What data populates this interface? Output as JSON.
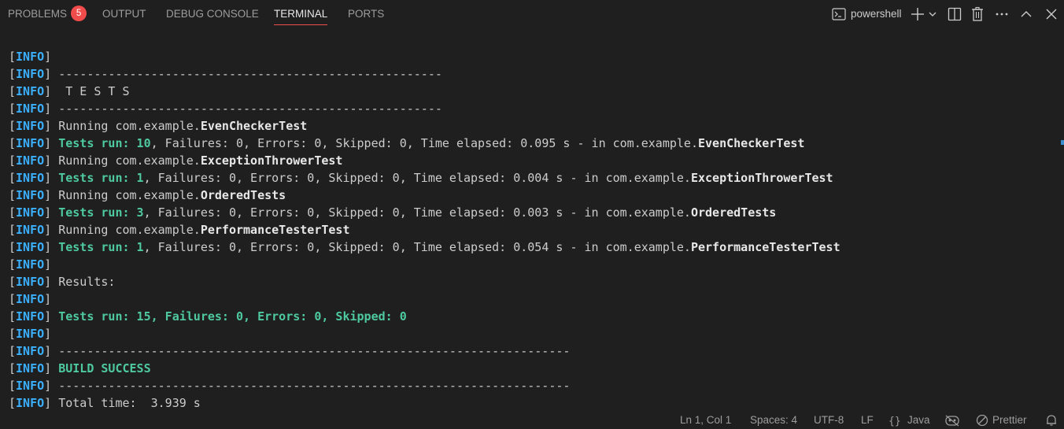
{
  "tabs": {
    "problems": "PROBLEMS",
    "problems_count": "5",
    "output": "OUTPUT",
    "debug_console": "DEBUG CONSOLE",
    "terminal": "TERMINAL",
    "ports": "PORTS"
  },
  "toolbar": {
    "shell": "powershell"
  },
  "terminal": {
    "lines": [
      [
        [
          "INFO"
        ]
      ],
      [
        [
          "INFO"
        ],
        [
          " ------------------------------------------------------",
          ""
        ]
      ],
      [
        [
          "INFO"
        ],
        [
          "  T E S T S",
          ""
        ]
      ],
      [
        [
          "INFO"
        ],
        [
          " ------------------------------------------------------",
          ""
        ]
      ],
      [
        [
          "INFO"
        ],
        [
          " Running com.example.",
          ""
        ],
        [
          "EvenCheckerTest",
          "b"
        ]
      ],
      [
        [
          "INFO"
        ],
        [
          " ",
          ""
        ],
        [
          "Tests run: 10",
          "g"
        ],
        [
          ", Failures: 0, Errors: 0, Skipped: 0, Time elapsed: 0.095 s - in com.example.",
          ""
        ],
        [
          "EvenCheckerTest",
          "b"
        ]
      ],
      [
        [
          "INFO"
        ],
        [
          " Running com.example.",
          ""
        ],
        [
          "ExceptionThrowerTest",
          "b"
        ]
      ],
      [
        [
          "INFO"
        ],
        [
          " ",
          ""
        ],
        [
          "Tests run: 1",
          "g"
        ],
        [
          ", Failures: 0, Errors: 0, Skipped: 0, Time elapsed: 0.004 s - in com.example.",
          ""
        ],
        [
          "ExceptionThrowerTest",
          "b"
        ]
      ],
      [
        [
          "INFO"
        ],
        [
          " Running com.example.",
          ""
        ],
        [
          "OrderedTests",
          "b"
        ]
      ],
      [
        [
          "INFO"
        ],
        [
          " ",
          ""
        ],
        [
          "Tests run: 3",
          "g"
        ],
        [
          ", Failures: 0, Errors: 0, Skipped: 0, Time elapsed: 0.003 s - in com.example.",
          ""
        ],
        [
          "OrderedTests",
          "b"
        ]
      ],
      [
        [
          "INFO"
        ],
        [
          " Running com.example.",
          ""
        ],
        [
          "PerformanceTesterTest",
          "b"
        ]
      ],
      [
        [
          "INFO"
        ],
        [
          " ",
          ""
        ],
        [
          "Tests run: 1",
          "g"
        ],
        [
          ", Failures: 0, Errors: 0, Skipped: 0, Time elapsed: 0.054 s - in com.example.",
          ""
        ],
        [
          "PerformanceTesterTest",
          "b"
        ]
      ],
      [
        [
          "INFO"
        ]
      ],
      [
        [
          "INFO"
        ],
        [
          " Results:",
          ""
        ]
      ],
      [
        [
          "INFO"
        ]
      ],
      [
        [
          "INFO"
        ],
        [
          " ",
          ""
        ],
        [
          "Tests run: 15, Failures: 0, Errors: 0, Skipped: 0",
          "g"
        ]
      ],
      [
        [
          "INFO"
        ]
      ],
      [
        [
          "INFO"
        ],
        [
          " ------------------------------------------------------------------------",
          ""
        ]
      ],
      [
        [
          "INFO"
        ],
        [
          " ",
          ""
        ],
        [
          "BUILD SUCCESS",
          "g"
        ]
      ],
      [
        [
          "INFO"
        ],
        [
          " ------------------------------------------------------------------------",
          ""
        ]
      ],
      [
        [
          "INFO"
        ],
        [
          " Total time:  3.939 s",
          ""
        ]
      ]
    ]
  },
  "statusbar": {
    "position": "Ln 1, Col 1",
    "spaces": "Spaces: 4",
    "encoding": "UTF-8",
    "eol": "LF",
    "language": "Java",
    "formatter": "Prettier"
  },
  "icons": {
    "terminal": "terminal-icon",
    "add": "plus-icon",
    "dropdown": "chevron-down-icon",
    "split": "split-terminal-icon",
    "trash": "trash-icon",
    "more": "ellipsis-icon",
    "maximize": "chevron-up-icon",
    "close": "close-icon",
    "braces": "braces-icon",
    "copilot": "copilot-icon",
    "prettier": "prettier-disabled-icon",
    "bell": "bell-icon"
  },
  "colors": {
    "background": "#1f1f1f",
    "text": "#cccccc",
    "info_tag": "#3ab0ff",
    "success_green": "#4ec9a0",
    "badge": "#f14c4c",
    "active_tab_underline": "#f14c4c"
  }
}
